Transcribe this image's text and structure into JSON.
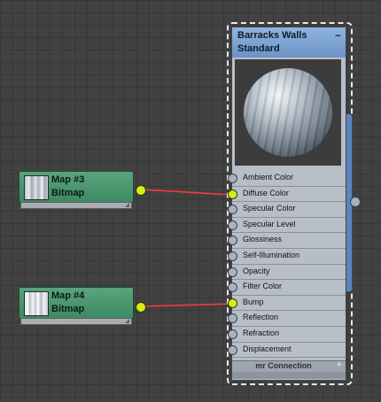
{
  "material": {
    "title": "Barracks Walls",
    "subtitle": "Standard",
    "minimize_icon": "−",
    "slots": [
      {
        "label": "Ambient Color",
        "connected": false
      },
      {
        "label": "Diffuse Color",
        "connected": true
      },
      {
        "label": "Specular Color",
        "connected": false
      },
      {
        "label": "Specular Level",
        "connected": false
      },
      {
        "label": "Glossiness",
        "connected": false
      },
      {
        "label": "Self-Illumination",
        "connected": false
      },
      {
        "label": "Opacity",
        "connected": false
      },
      {
        "label": "Filter Color",
        "connected": false
      },
      {
        "label": "Bump",
        "connected": true
      },
      {
        "label": "Reflection",
        "connected": false
      },
      {
        "label": "Refraction",
        "connected": false
      },
      {
        "label": "Displacement",
        "connected": false
      }
    ],
    "footer_label": "mr Connection",
    "footer_icon": "+"
  },
  "maps": [
    {
      "title": "Map #3",
      "type": "Bitmap",
      "connects_to": "Diffuse Color"
    },
    {
      "title": "Map #4",
      "type": "Bitmap",
      "connects_to": "Bump"
    }
  ],
  "colors": {
    "wire": "#ff3b3b",
    "socket_active": "#d6ee12",
    "map_node": "#4e9a72",
    "material_header": "#7ea5d6"
  }
}
